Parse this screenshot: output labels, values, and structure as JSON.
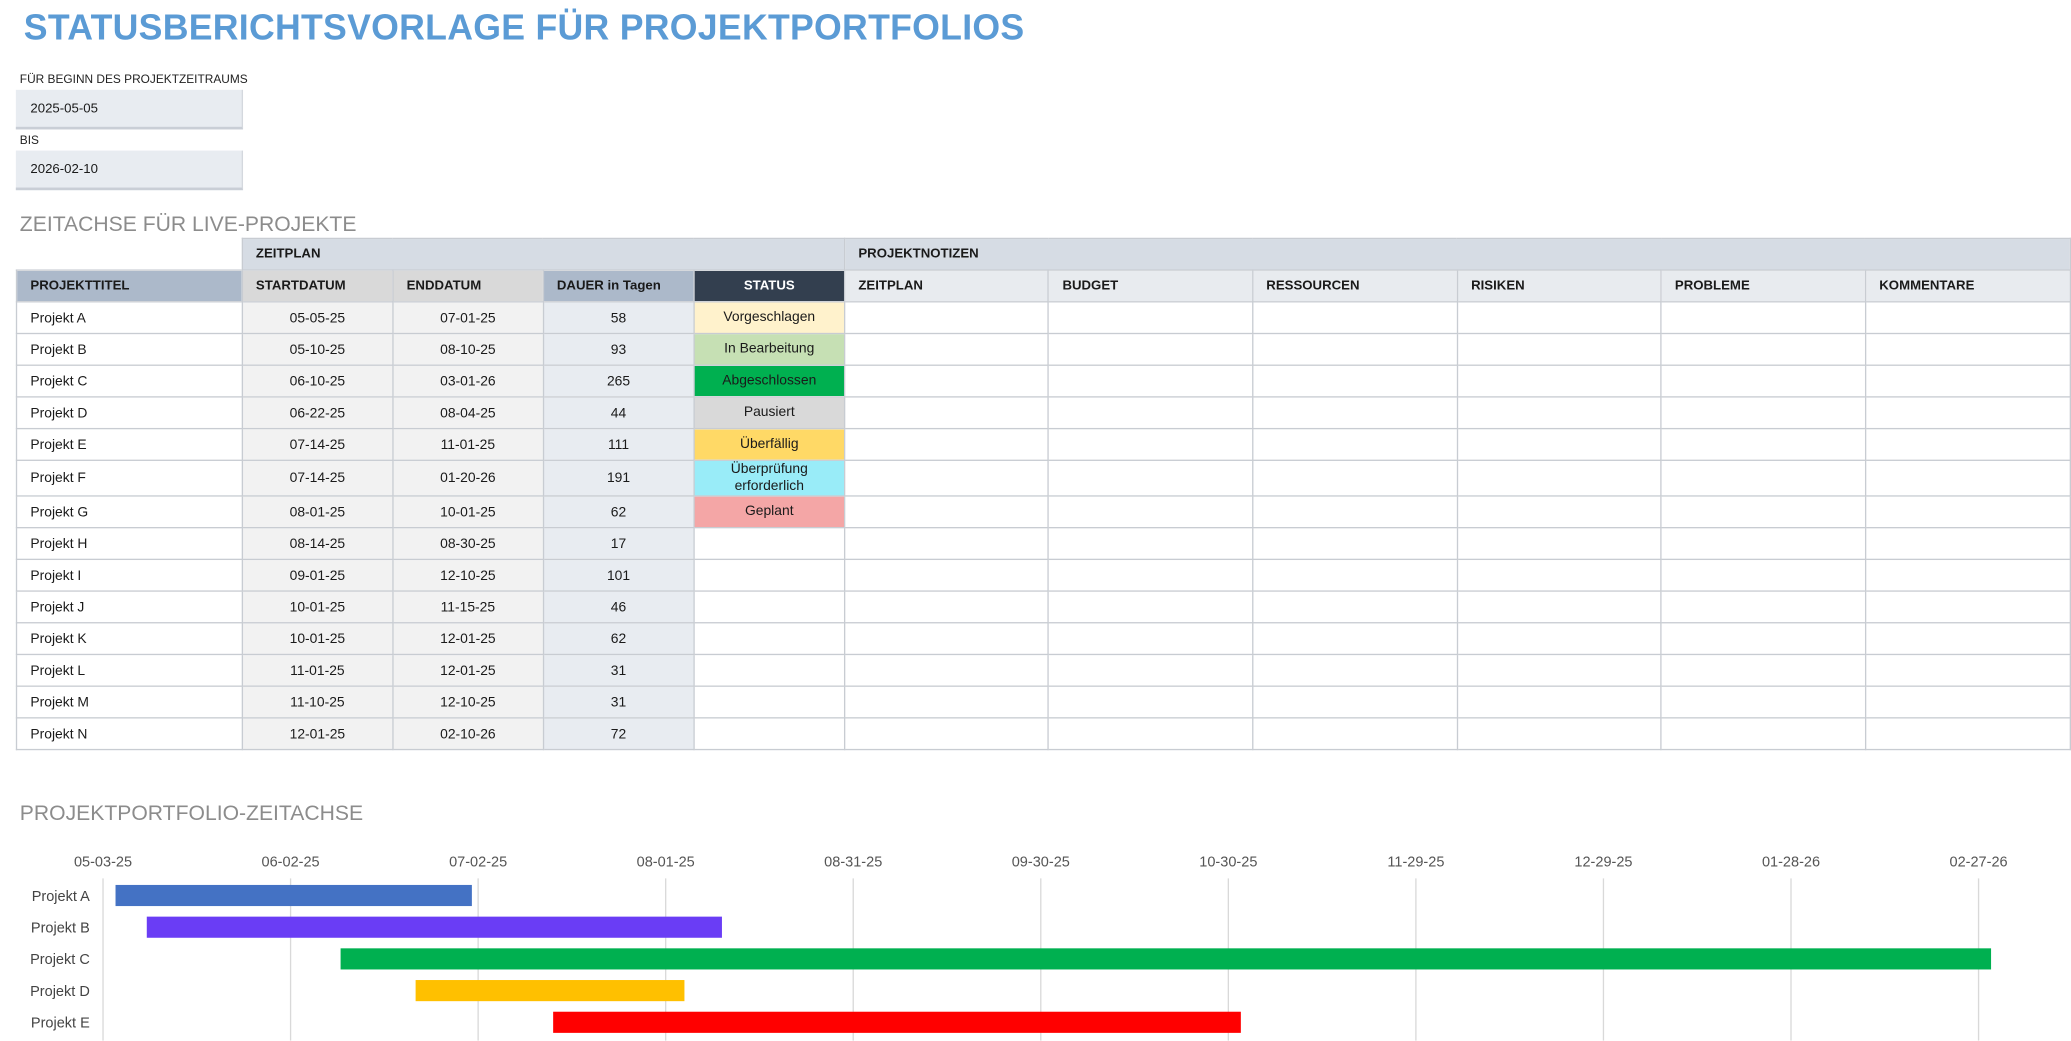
{
  "title": "STATUSBERICHTSVORLAGE FÜR PROJEKTPORTFOLIOS",
  "period": {
    "start_label": "FÜR BEGINN DES PROJEKTZEITRAUMS",
    "start_value": "2025-05-05",
    "end_label": "BIS",
    "end_value": "2026-02-10"
  },
  "timeline_section_title": "ZEITACHSE FÜR LIVE-PROJEKTE",
  "table": {
    "group_headers": {
      "schedule": "ZEITPLAN",
      "notes": "PROJEKTNOTIZEN"
    },
    "columns": [
      "PROJEKTTITEL",
      "STARTDATUM",
      "ENDDATUM",
      "DAUER in Tagen",
      "STATUS",
      "ZEITPLAN",
      "BUDGET",
      "RESSOURCEN",
      "RISIKEN",
      "PROBLEME",
      "KOMMENTARE"
    ],
    "rows": [
      {
        "title": "Projekt A",
        "start": "05-05-25",
        "end": "07-01-25",
        "duration": "58",
        "status": "Vorgeschlagen",
        "status_color": "#fff2cc"
      },
      {
        "title": "Projekt B",
        "start": "05-10-25",
        "end": "08-10-25",
        "duration": "93",
        "status": "In Bearbeitung",
        "status_color": "#c6e0b4"
      },
      {
        "title": "Projekt C",
        "start": "06-10-25",
        "end": "03-01-26",
        "duration": "265",
        "status": "Abgeschlossen",
        "status_color": "#00b050"
      },
      {
        "title": "Projekt D",
        "start": "06-22-25",
        "end": "08-04-25",
        "duration": "44",
        "status": "Pausiert",
        "status_color": "#d9d9d9"
      },
      {
        "title": "Projekt E",
        "start": "07-14-25",
        "end": "11-01-25",
        "duration": "111",
        "status": "Überfällig",
        "status_color": "#ffd966"
      },
      {
        "title": "Projekt F",
        "start": "07-14-25",
        "end": "01-20-26",
        "duration": "191",
        "status": "Überprüfung erforderlich",
        "status_color": "#99ecf8"
      },
      {
        "title": "Projekt G",
        "start": "08-01-25",
        "end": "10-01-25",
        "duration": "62",
        "status": "Geplant",
        "status_color": "#f4a6a6"
      },
      {
        "title": "Projekt H",
        "start": "08-14-25",
        "end": "08-30-25",
        "duration": "17",
        "status": "",
        "status_color": "#ffffff"
      },
      {
        "title": "Projekt I",
        "start": "09-01-25",
        "end": "12-10-25",
        "duration": "101",
        "status": "",
        "status_color": "#ffffff"
      },
      {
        "title": "Projekt J",
        "start": "10-01-25",
        "end": "11-15-25",
        "duration": "46",
        "status": "",
        "status_color": "#ffffff"
      },
      {
        "title": "Projekt K",
        "start": "10-01-25",
        "end": "12-01-25",
        "duration": "62",
        "status": "",
        "status_color": "#ffffff"
      },
      {
        "title": "Projekt L",
        "start": "11-01-25",
        "end": "12-01-25",
        "duration": "31",
        "status": "",
        "status_color": "#ffffff"
      },
      {
        "title": "Projekt M",
        "start": "11-10-25",
        "end": "12-10-25",
        "duration": "31",
        "status": "",
        "status_color": "#ffffff"
      },
      {
        "title": "Projekt N",
        "start": "12-01-25",
        "end": "02-10-26",
        "duration": "72",
        "status": "",
        "status_color": "#ffffff"
      }
    ]
  },
  "portfolio_section_title": "PROJEKTPORTFOLIO-ZEITACHSE",
  "chart_data": {
    "type": "bar",
    "orientation": "horizontal",
    "x_ticks": [
      "05-03-25",
      "06-02-25",
      "07-02-25",
      "08-01-25",
      "08-31-25",
      "09-30-25",
      "10-30-25",
      "11-29-25",
      "12-29-25",
      "01-28-26",
      "02-27-26"
    ],
    "xlim": [
      "05-03-25",
      "02-27-26"
    ],
    "grid": true,
    "bars": [
      {
        "label": "Projekt A",
        "start": "05-05-25",
        "end": "07-01-25",
        "color": "#4472c4"
      },
      {
        "label": "Projekt B",
        "start": "05-10-25",
        "end": "08-10-25",
        "color": "#6a3df5"
      },
      {
        "label": "Projekt C",
        "start": "06-10-25",
        "end": "03-01-26",
        "color": "#00b050"
      },
      {
        "label": "Projekt D",
        "start": "06-22-25",
        "end": "08-04-25",
        "color": "#ffc000"
      },
      {
        "label": "Projekt E",
        "start": "07-14-25",
        "end": "11-01-25",
        "color": "#ff0000"
      }
    ]
  }
}
